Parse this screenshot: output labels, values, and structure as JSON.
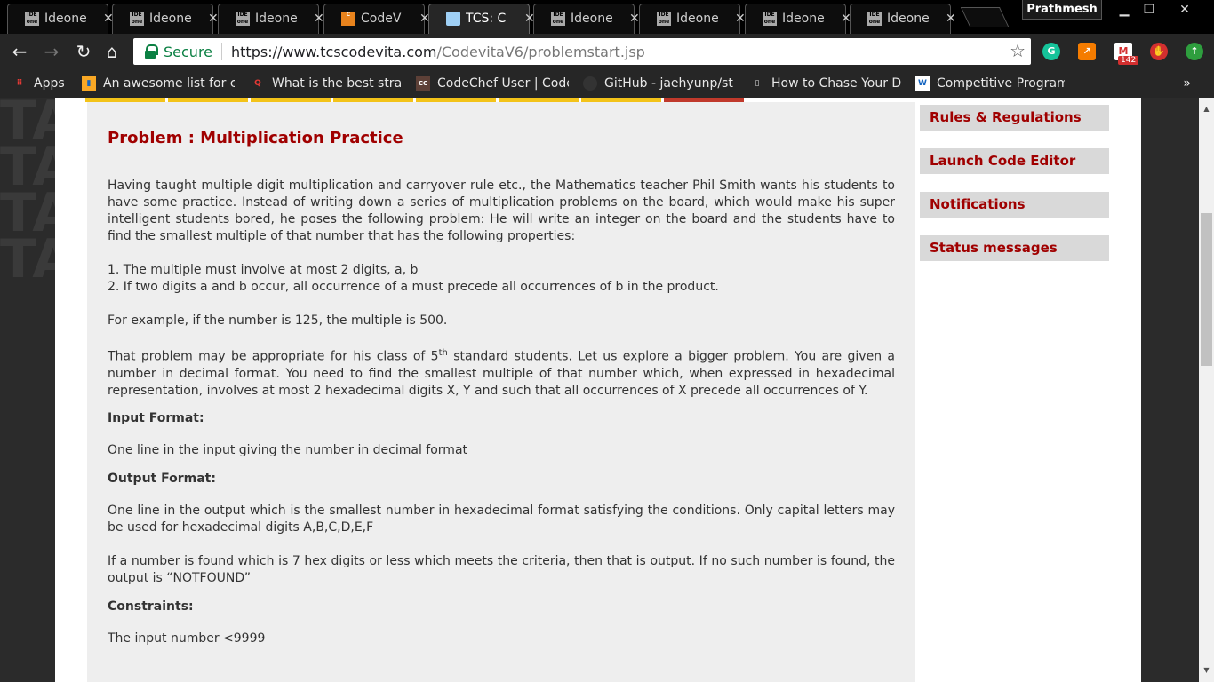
{
  "tabs": [
    {
      "title": "Ideone",
      "icon": "ideone-icon"
    },
    {
      "title": "Ideone",
      "icon": "ideone-icon"
    },
    {
      "title": "Ideone",
      "icon": "ideone-icon"
    },
    {
      "title": "CodeV",
      "icon": "codechef-icon"
    },
    {
      "title": "TCS: C",
      "icon": "tcs-icon",
      "active": true
    },
    {
      "title": "Ideone",
      "icon": "ideone-icon"
    },
    {
      "title": "Ideone",
      "icon": "ideone-icon"
    },
    {
      "title": "Ideone",
      "icon": "ideone-icon"
    },
    {
      "title": "Ideone",
      "icon": "ideone-icon"
    }
  ],
  "profile_name": "Prathmesh",
  "address": {
    "secure_label": "Secure",
    "url_host": "https://www.tcscodevita.com",
    "url_path": "/CodevitaV6/problemstart.jsp"
  },
  "extensions": {
    "mail_badge": "142"
  },
  "bookmarks": [
    {
      "label": "Apps"
    },
    {
      "label": "An awesome list for c"
    },
    {
      "label": "What is the best strat"
    },
    {
      "label": "CodeChef User | Code"
    },
    {
      "label": "GitHub - jaehyunp/st"
    },
    {
      "label": "How to Chase Your D"
    },
    {
      "label": "Competitive Program"
    }
  ],
  "bookmarks_more": "»",
  "problem": {
    "title": "Problem : Multiplication Practice",
    "intro": "Having taught multiple digit multiplication and carryover rule etc., the Mathematics teacher Phil Smith wants his students to have some practice. Instead of writing down a series of multiplication problems on the board, which would make his super intelligent students bored, he poses the following problem: He will write an integer on the board and the students have to find the smallest multiple of that number that has the following properties:",
    "rule1": "1. The multiple must involve at most 2 digits, a, b",
    "rule2": "2. If two digits a and b occur, all occurrence of a must precede all occurrences of b in the product.",
    "example": "For example, if the number is 125, the multiple is 500.",
    "bigger_pre": "That problem may be appropriate for his class of 5",
    "bigger_sup": "th",
    "bigger_post": " standard students. Let us explore a bigger problem. You are given a number in decimal format. You need to find the smallest multiple of that number which, when expressed in hexadecimal representation, involves at most 2 hexadecimal digits X, Y and such that all occurrences of X precede all occurrences of Y.",
    "input_heading": "Input Format:",
    "input_text": "One line in the input giving the number in decimal format",
    "output_heading": "Output Format:",
    "output_text1": "One line in the output which is the smallest number in hexadecimal format satisfying the conditions. Only capital letters may be used for hexadecimal digits A,B,C,D,E,F",
    "output_text2": "If a number is found which is 7 hex digits or less which meets the criteria, then that is output. If no such number is found, the output is “NOTFOUND”",
    "constraints_heading": "Constraints:",
    "constraints_text": "The input number <9999"
  },
  "sidebar": {
    "rules": "Rules & Regulations",
    "launch": "Launch Code Editor",
    "notifications": "Notifications",
    "status": "Status messages"
  }
}
